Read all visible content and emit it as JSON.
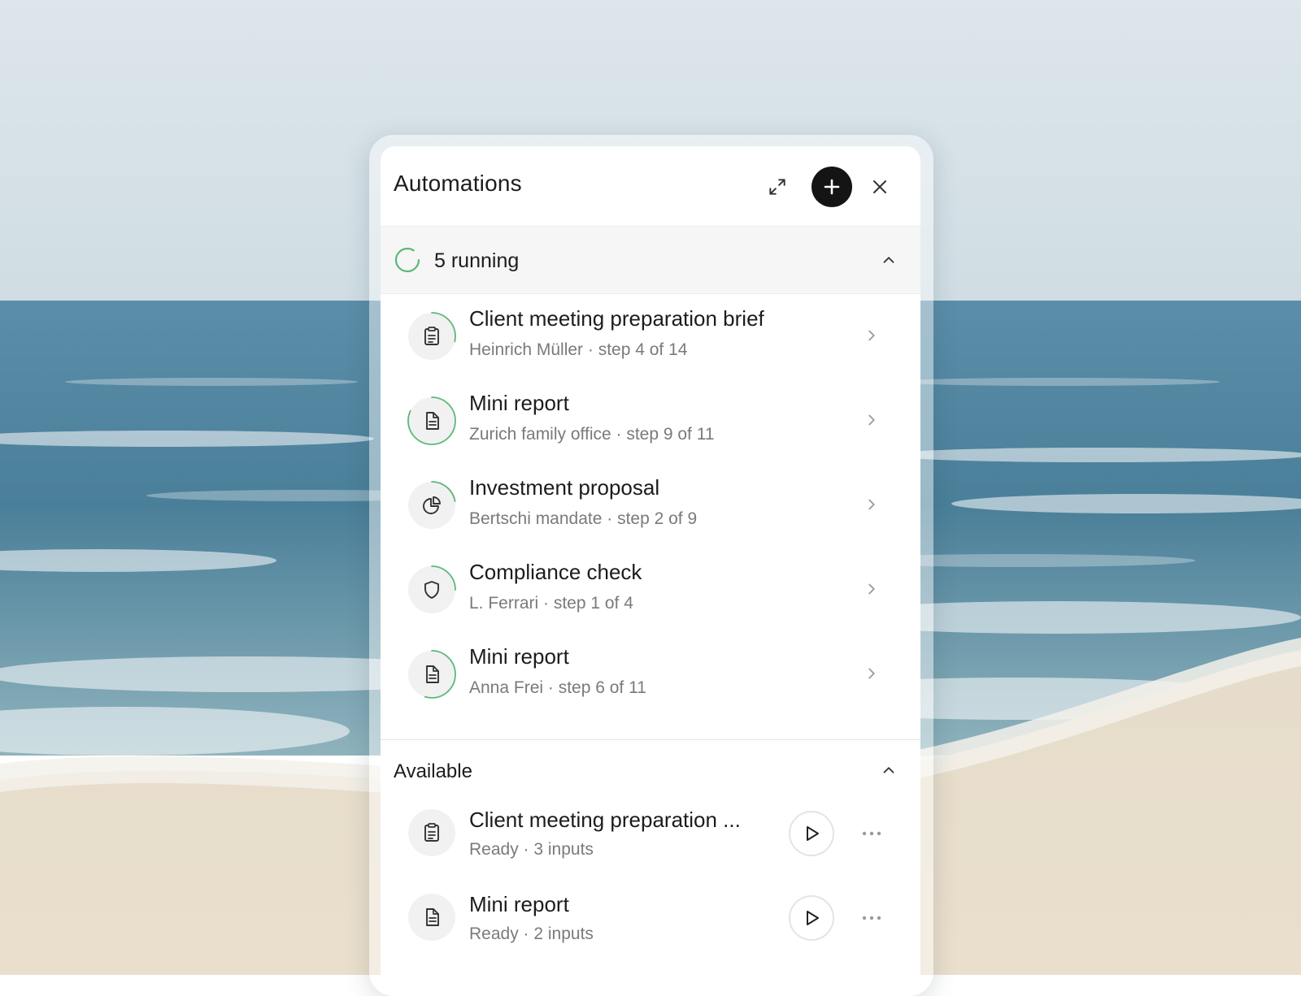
{
  "panel": {
    "title": "Automations"
  },
  "header_icons": {
    "expand": "expand-icon",
    "add": "plus-icon",
    "close": "close-icon"
  },
  "running": {
    "label": "5 running",
    "count": 5,
    "expanded": true,
    "items": [
      {
        "title": "Client meeting preparation brief",
        "subtitle": "Heinrich Müller · step 4 of 14",
        "step": 4,
        "total_steps": 14,
        "icon": "clipboard-icon"
      },
      {
        "title": "Mini report",
        "subtitle": "Zurich family office · step 9 of 11",
        "step": 9,
        "total_steps": 11,
        "icon": "document-icon"
      },
      {
        "title": "Investment proposal",
        "subtitle": "Bertschi mandate · step 2 of 9",
        "step": 2,
        "total_steps": 9,
        "icon": "pie-chart-icon"
      },
      {
        "title": "Compliance check",
        "subtitle": "L. Ferrari · step 1 of 4",
        "step": 1,
        "total_steps": 4,
        "icon": "shield-icon"
      },
      {
        "title": "Mini report",
        "subtitle": "Anna Frei · step 6 of 11",
        "step": 6,
        "total_steps": 11,
        "icon": "document-icon"
      }
    ]
  },
  "available": {
    "label": "Available",
    "expanded": true,
    "items": [
      {
        "title": "Client meeting preparation ...",
        "subtitle": "Ready · 3 inputs",
        "icon": "clipboard-icon"
      },
      {
        "title": "Mini report",
        "subtitle": "Ready · 2 inputs",
        "icon": "document-icon"
      }
    ]
  },
  "colors": {
    "progress_ring": "#5cb87a",
    "icon_bg": "#f1f1f1",
    "add_button_bg": "#141414",
    "subtitle_text": "#7a7a7a"
  }
}
